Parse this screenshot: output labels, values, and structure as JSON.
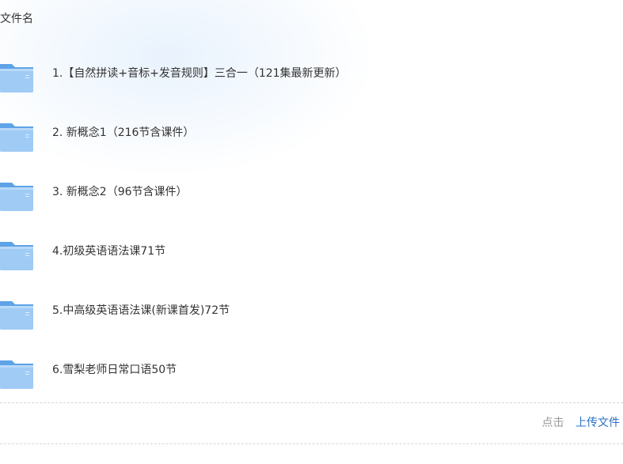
{
  "header": {
    "column_label": "文件名"
  },
  "files": [
    {
      "name": "1.【自然拼读+音标+发音规则】三合一（121集最新更新）",
      "icon": "folder-icon"
    },
    {
      "name": "2. 新概念1（216节含课件）",
      "icon": "folder-icon"
    },
    {
      "name": "3. 新概念2（96节含课件）",
      "icon": "folder-icon"
    },
    {
      "name": "4.初级英语语法课71节",
      "icon": "folder-icon"
    },
    {
      "name": "5.中高级英语语法课(新课首发)72节",
      "icon": "folder-icon"
    },
    {
      "name": "6.雪梨老师日常口语50节",
      "icon": "folder-icon"
    }
  ],
  "footer": {
    "hint": "点击",
    "upload_label": "上传文件"
  },
  "colors": {
    "folder_back": "#5ea3e6",
    "folder_front": "#9fcbf5",
    "link": "#2a6fc9"
  }
}
